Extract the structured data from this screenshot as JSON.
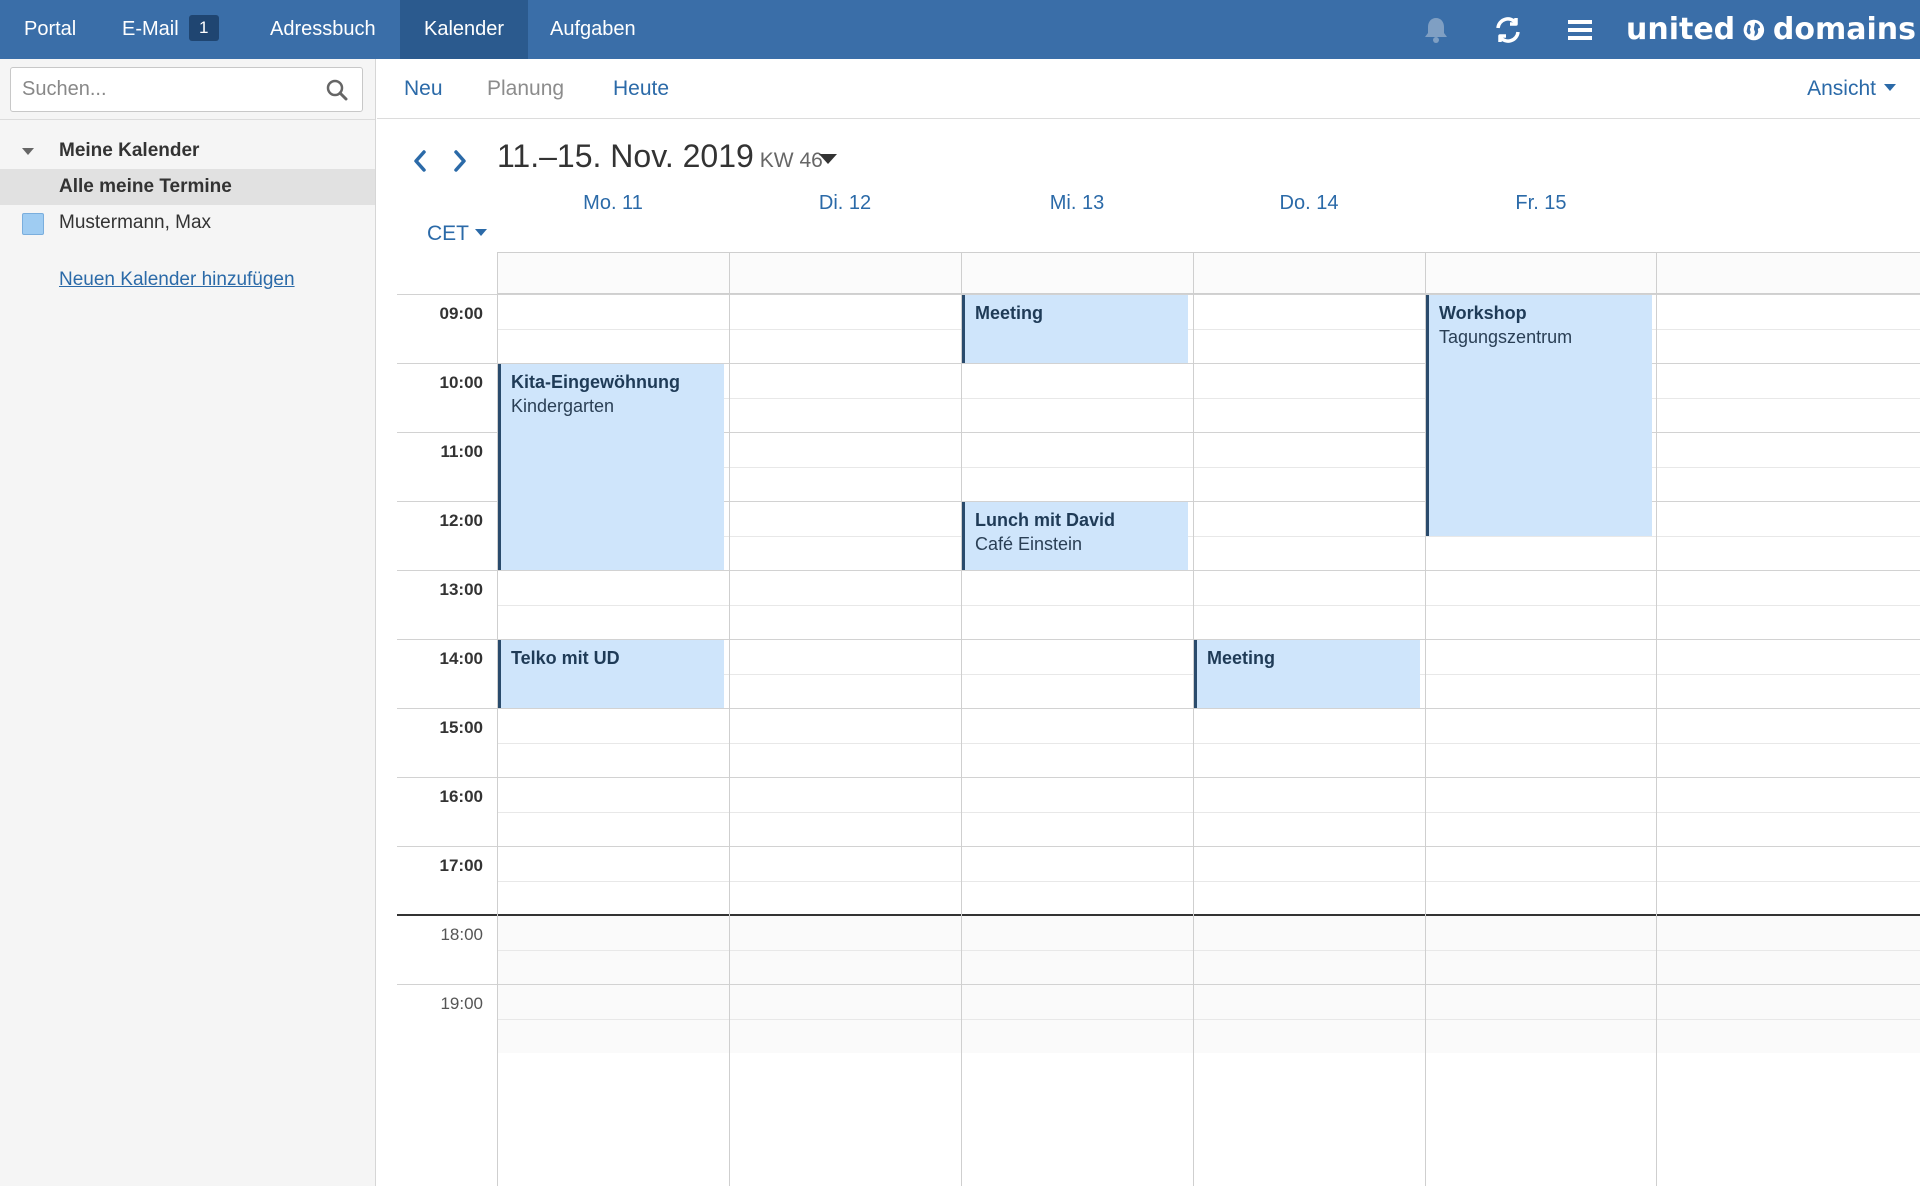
{
  "nav": {
    "items": [
      "Portal",
      "E-Mail",
      "Adressbuch",
      "Kalender",
      "Aufgaben"
    ],
    "email_badge": "1",
    "active": "Kalender",
    "logo_text_left": "united",
    "logo_text_right": "domains",
    "icons": [
      "bell-icon",
      "refresh-icon",
      "menu-icon"
    ]
  },
  "sidebar": {
    "search_placeholder": "Suchen...",
    "section_title": "Meine Kalender",
    "all_appointments": "Alle meine Termine",
    "calendar_name": "Mustermann, Max",
    "calendar_color": "#9fccf2",
    "add_calendar": "Neuen Kalender hinzufügen"
  },
  "toolbar": {
    "new": "Neu",
    "planning": "Planung",
    "today": "Heute",
    "view": "Ansicht"
  },
  "calendar": {
    "range_title": "11.–15. Nov. 2019",
    "week": "KW 46",
    "timezone": "CET",
    "days": [
      "Mo. 11",
      "Di. 12",
      "Mi. 13",
      "Do. 14",
      "Fr. 15"
    ],
    "hours": [
      "09:00",
      "10:00",
      "11:00",
      "12:00",
      "13:00",
      "14:00",
      "15:00",
      "16:00",
      "17:00",
      "18:00",
      "19:00"
    ],
    "events": [
      {
        "title": "Meeting",
        "location": "",
        "day": 2,
        "start": 9.0,
        "end": 10.0
      },
      {
        "title": "Workshop",
        "location": "Tagungszentrum",
        "day": 4,
        "start": 9.0,
        "end": 12.5
      },
      {
        "title": "Kita-Eingewöhnung",
        "location": "Kindergarten",
        "day": 0,
        "start": 10.0,
        "end": 13.0
      },
      {
        "title": "Lunch mit David",
        "location": "Café Einstein",
        "day": 2,
        "start": 12.0,
        "end": 13.0
      },
      {
        "title": "Telko mit UD",
        "location": "",
        "day": 0,
        "start": 14.0,
        "end": 15.0
      },
      {
        "title": "Meeting",
        "location": "",
        "day": 3,
        "start": 14.0,
        "end": 15.0
      }
    ],
    "event_color": "#cfe5fb",
    "event_border_color": "#2a4b6c"
  }
}
